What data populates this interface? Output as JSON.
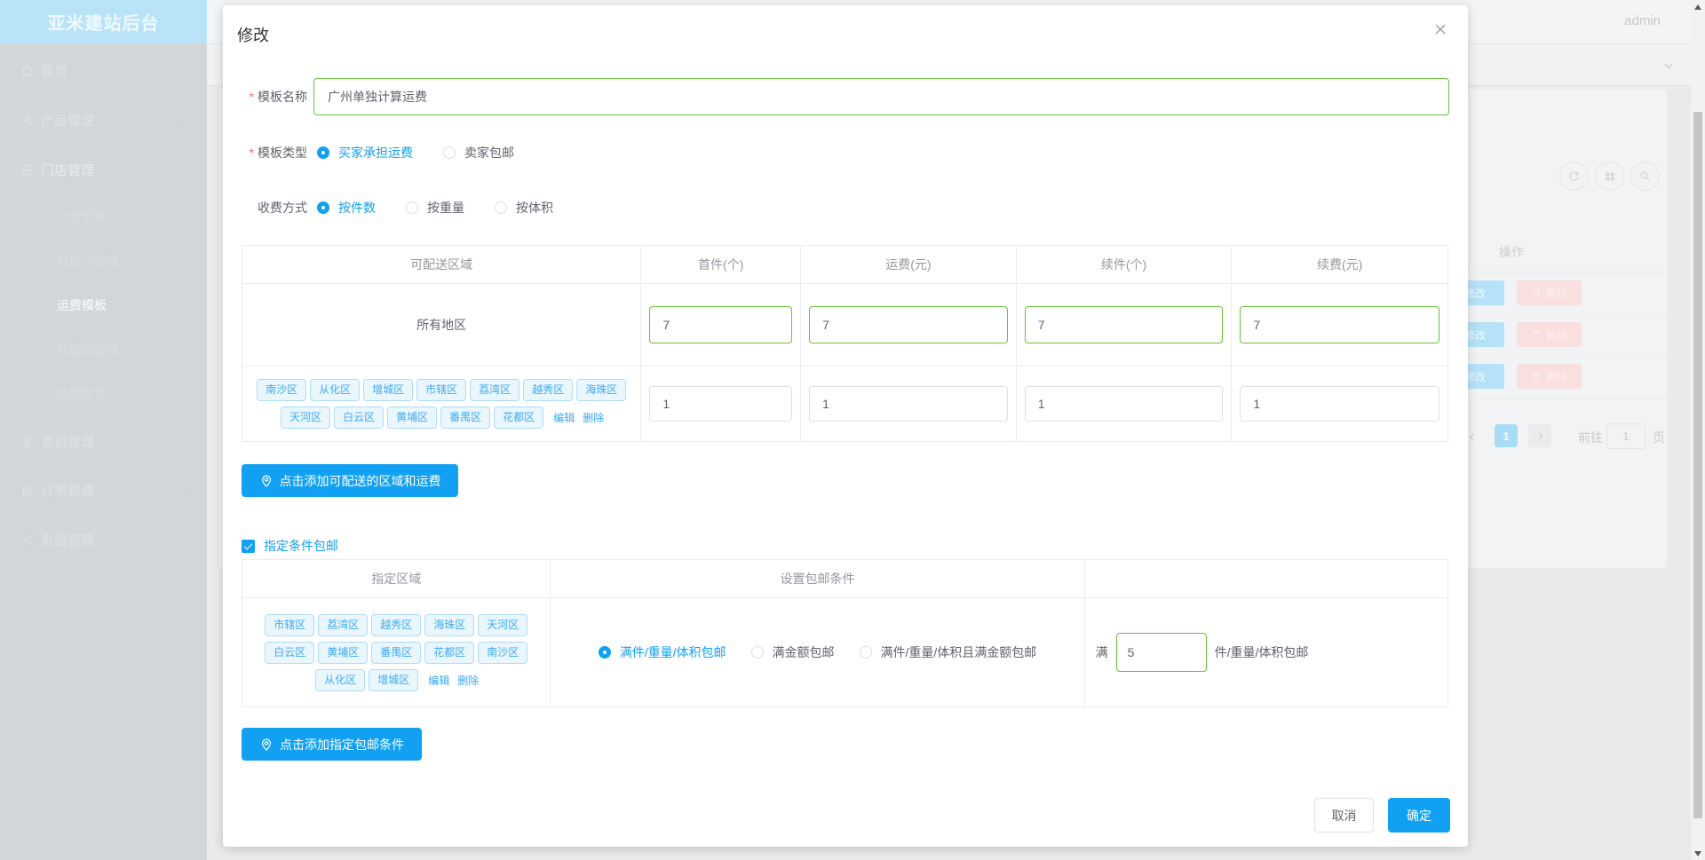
{
  "app": {
    "title": "亚米建站后台",
    "user": "admin"
  },
  "sidebar": {
    "items": [
      {
        "label": "首页",
        "icon": "home-icon"
      },
      {
        "label": "产品管理",
        "icon": "user-icon",
        "chevron": "down"
      },
      {
        "label": "门店管理",
        "icon": "shop-icon",
        "chevron": "up",
        "children": [
          "公告管理",
          "自提点管理",
          "运费模板",
          "轮播图管理",
          "热搜管理"
        ],
        "active_child": "运费模板"
      },
      {
        "label": "会员管理",
        "icon": "badge-icon",
        "chevron": "down"
      },
      {
        "label": "订单管理",
        "icon": "order-icon",
        "chevron": "down"
      },
      {
        "label": "系统管理",
        "icon": "gear-icon",
        "chevron": "down"
      }
    ]
  },
  "background": {
    "panel": {
      "actions_header": "操作",
      "edit_label": "修改",
      "delete_label": "删除"
    },
    "pagination": {
      "active_page": "1",
      "goto_label": "前往",
      "page_value": "1",
      "page_suffix": "页"
    }
  },
  "modal": {
    "title": "修改",
    "fields": {
      "template_name": {
        "label": "模板名称",
        "value": "广州单独计算运费",
        "required": true
      },
      "template_type": {
        "label": "模板类型",
        "required": true,
        "options": [
          {
            "label": "买家承担运费",
            "selected": true
          },
          {
            "label": "卖家包邮",
            "selected": false
          }
        ]
      },
      "charge_method": {
        "label": "收费方式",
        "options": [
          {
            "label": "按件数",
            "selected": true
          },
          {
            "label": "按重量",
            "selected": false
          },
          {
            "label": "按体积",
            "selected": false
          }
        ]
      }
    },
    "shipping_table": {
      "headers": [
        "可配送区域",
        "首件(个)",
        "运费(元)",
        "续件(个)",
        "续费(元)"
      ],
      "rows": [
        {
          "region": "所有地区",
          "first": "7",
          "fee": "7",
          "additional": "7",
          "additional_fee": "7"
        },
        {
          "tags": [
            "南沙区",
            "从化区",
            "增城区",
            "市辖区",
            "荔湾区",
            "越秀区",
            "海珠区",
            "天河区",
            "白云区",
            "黄埔区",
            "番禺区",
            "花都区"
          ],
          "edit_label": "编辑",
          "delete_label": "删除",
          "first": "1",
          "fee": "1",
          "additional": "1",
          "additional_fee": "1"
        }
      ]
    },
    "add_region_button": "点击添加可配送的区域和运费",
    "free_shipping": {
      "label": "指定条件包邮",
      "checked": true
    },
    "condition_table": {
      "headers": [
        "指定区域",
        "设置包邮条件"
      ],
      "row": {
        "tags": [
          "市辖区",
          "荔湾区",
          "越秀区",
          "海珠区",
          "天河区",
          "白云区",
          "黄埔区",
          "番禺区",
          "花都区",
          "南沙区",
          "从化区",
          "增城区"
        ],
        "edit_label": "编辑",
        "delete_label": "删除",
        "options": [
          {
            "label": "满件/重量/体积包邮",
            "selected": true
          },
          {
            "label": "满金额包邮",
            "selected": false
          },
          {
            "label": "满件/重量/体积且满金额包邮",
            "selected": false
          }
        ],
        "threshold": {
          "prefix": "满",
          "value": "5",
          "suffix": "件/重量/体积包邮"
        }
      }
    },
    "add_condition_button": "点击添加指定包邮条件",
    "footer": {
      "cancel": "取消",
      "confirm": "确定"
    }
  },
  "colors": {
    "primary": "#12a0f2",
    "success": "#67c23a",
    "danger": "#f56c6c",
    "sidebar_header": "#b9e3f7"
  }
}
